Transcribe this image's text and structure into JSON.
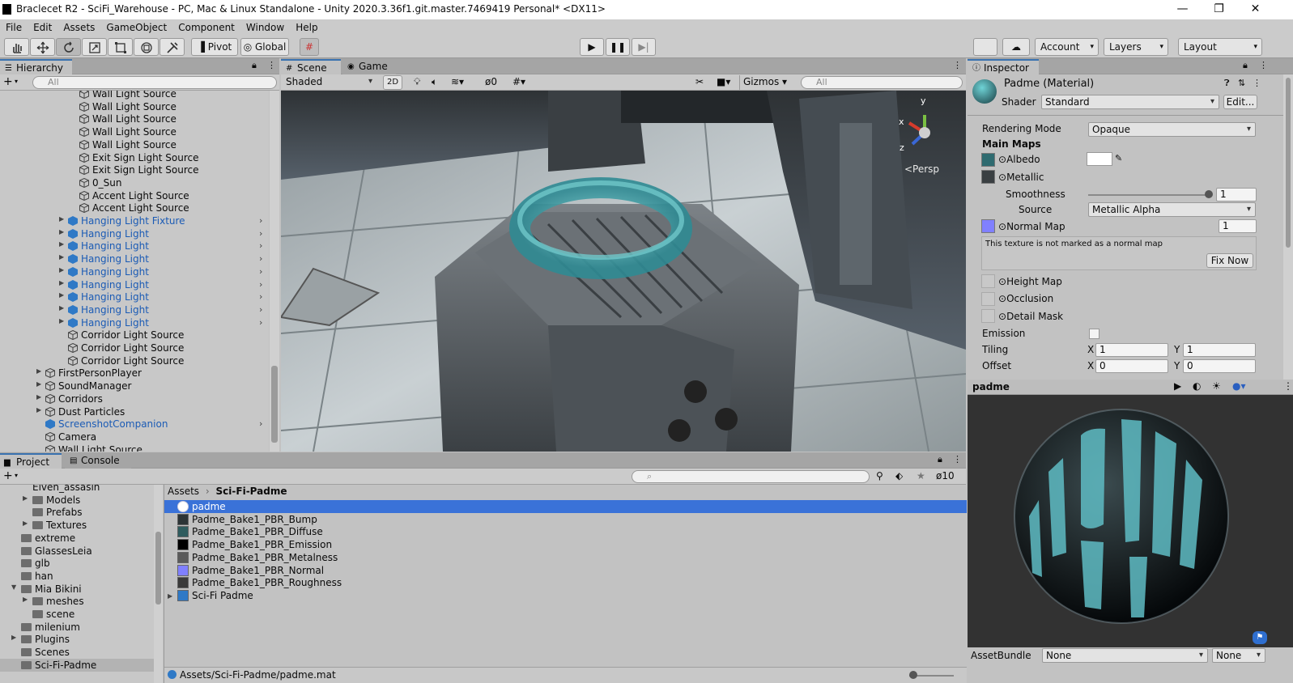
{
  "window": {
    "title": "Braclecet R2 - SciFi_Warehouse - PC, Mac & Linux Standalone - Unity 2020.3.36f1.git.master.7469419 Personal* <DX11>"
  },
  "menu": [
    "File",
    "Edit",
    "Assets",
    "GameObject",
    "Component",
    "Window",
    "Help"
  ],
  "toolbar": {
    "pivot": "Pivot",
    "global": "Global",
    "account": "Account",
    "layers": "Layers",
    "layout": "Layout"
  },
  "hierarchy": {
    "tab": "Hierarchy",
    "search_placeholder": "All",
    "items": [
      {
        "label": "Wall Light Source",
        "blue": false
      },
      {
        "label": "Wall Light Source",
        "blue": false
      },
      {
        "label": "Wall Light Source",
        "blue": false
      },
      {
        "label": "Wall Light Source",
        "blue": false
      },
      {
        "label": "Wall Light Source",
        "blue": false
      },
      {
        "label": "Exit Sign Light Source",
        "blue": false
      },
      {
        "label": "Exit Sign Light Source",
        "blue": false
      },
      {
        "label": "0_Sun",
        "blue": false
      },
      {
        "label": "Accent Light Source",
        "blue": false
      },
      {
        "label": "Accent Light Source",
        "blue": false
      },
      {
        "label": "Hanging Light Fixture",
        "blue": true
      },
      {
        "label": "Hanging Light",
        "blue": true
      },
      {
        "label": "Hanging Light",
        "blue": true
      },
      {
        "label": "Hanging Light",
        "blue": true
      },
      {
        "label": "Hanging Light",
        "blue": true
      },
      {
        "label": "Hanging Light",
        "blue": true
      },
      {
        "label": "Hanging Light",
        "blue": true
      },
      {
        "label": "Hanging Light",
        "blue": true
      },
      {
        "label": "Hanging Light",
        "blue": true
      },
      {
        "label": "Corridor Light Source",
        "blue": false
      },
      {
        "label": "Corridor Light Source",
        "blue": false
      },
      {
        "label": "Corridor Light Source",
        "blue": false
      },
      {
        "label": "FirstPersonPlayer",
        "blue": false
      },
      {
        "label": "SoundManager",
        "blue": false
      },
      {
        "label": "Corridors",
        "blue": false
      },
      {
        "label": "Dust Particles",
        "blue": false
      },
      {
        "label": "ScreenshotCompanion",
        "blue": true
      },
      {
        "label": "Camera",
        "blue": false
      },
      {
        "label": "Wall Light Source",
        "blue": false
      }
    ]
  },
  "scene": {
    "tab_scene": "Scene",
    "tab_game": "Game",
    "shading": "Shaded",
    "mode_2d": "2D",
    "hidden_count": "0",
    "gizmos": "Gizmos",
    "search_placeholder": "All",
    "persp": "<Persp",
    "axis_x": "x",
    "axis_y": "y",
    "axis_z": "z"
  },
  "inspector": {
    "tab": "Inspector",
    "material_name": "Padme (Material)",
    "shader_label": "Shader",
    "shader_value": "Standard",
    "edit": "Edit...",
    "rendering_mode_label": "Rendering Mode",
    "rendering_mode_value": "Opaque",
    "main_maps": "Main Maps",
    "albedo": "Albedo",
    "metallic": "Metallic",
    "smoothness_label": "Smoothness",
    "smoothness_value": "1",
    "smoothness_level": 1,
    "source_label": "Source",
    "source_value": "Metallic Alpha",
    "normal_map": "Normal Map",
    "normal_value": "1",
    "normal_warning": "This texture is not marked as a normal map",
    "fix_now": "Fix Now",
    "height_map": "Height Map",
    "occlusion": "Occlusion",
    "detail_mask": "Detail Mask",
    "emission": "Emission",
    "tiling": "Tiling",
    "offset": "Offset",
    "tiling_x": "1",
    "tiling_y": "1",
    "offset_x": "0",
    "offset_y": "0",
    "x": "X",
    "y": "Y"
  },
  "preview": {
    "title": "padme",
    "assetbundle_label": "AssetBundle",
    "assetbundle_value": "None",
    "variant_value": "None"
  },
  "project": {
    "tab_project": "Project",
    "tab_console": "Console",
    "hidden_count": "10",
    "tree": [
      {
        "label": "Elven_assasin",
        "indent": 2,
        "arrow": "none",
        "folder": false
      },
      {
        "label": "Models",
        "indent": 2,
        "arrow": "right",
        "folder": true
      },
      {
        "label": "Prefabs",
        "indent": 2,
        "arrow": "none",
        "folder": true
      },
      {
        "label": "Textures",
        "indent": 2,
        "arrow": "right",
        "folder": true
      },
      {
        "label": "extreme",
        "indent": 1,
        "arrow": "none",
        "folder": true
      },
      {
        "label": "GlassesLeia",
        "indent": 1,
        "arrow": "none",
        "folder": true
      },
      {
        "label": "glb",
        "indent": 1,
        "arrow": "none",
        "folder": true
      },
      {
        "label": "han",
        "indent": 1,
        "arrow": "none",
        "folder": true
      },
      {
        "label": "Mia Bikini",
        "indent": 1,
        "arrow": "down",
        "folder": true
      },
      {
        "label": "meshes",
        "indent": 2,
        "arrow": "right",
        "folder": true
      },
      {
        "label": "scene",
        "indent": 2,
        "arrow": "none",
        "folder": true
      },
      {
        "label": "milenium",
        "indent": 1,
        "arrow": "none",
        "folder": true
      },
      {
        "label": "Plugins",
        "indent": 1,
        "arrow": "right",
        "folder": true
      },
      {
        "label": "Scenes",
        "indent": 1,
        "arrow": "none",
        "folder": true
      },
      {
        "label": "Sci-Fi-Padme",
        "indent": 1,
        "arrow": "none",
        "folder": true
      }
    ],
    "breadcrumb_root": "Assets",
    "breadcrumb_current": "Sci-Fi-Padme",
    "files": [
      {
        "label": "padme",
        "selected": true,
        "thumb": "#ffffff"
      },
      {
        "label": "Padme_Bake1_PBR_Bump",
        "selected": false,
        "thumb": "#2c3436"
      },
      {
        "label": "Padme_Bake1_PBR_Diffuse",
        "selected": false,
        "thumb": "#2f5c5e"
      },
      {
        "label": "Padme_Bake1_PBR_Emission",
        "selected": false,
        "thumb": "#000000"
      },
      {
        "label": "Padme_Bake1_PBR_Metalness",
        "selected": false,
        "thumb": "#5a5a5a"
      },
      {
        "label": "Padme_Bake1_PBR_Normal",
        "selected": false,
        "thumb": "#8080ff"
      },
      {
        "label": "Padme_Bake1_PBR_Roughness",
        "selected": false,
        "thumb": "#3a3a3a"
      },
      {
        "label": "Sci-Fi Padme",
        "selected": false,
        "thumb": "#2f79c6"
      }
    ],
    "status_path": "Assets/Sci-Fi-Padme/padme.mat"
  },
  "colors": {
    "selection": "#3a72d8",
    "link_blue": "#1b5bb5",
    "normal_map": "#8080ff"
  }
}
